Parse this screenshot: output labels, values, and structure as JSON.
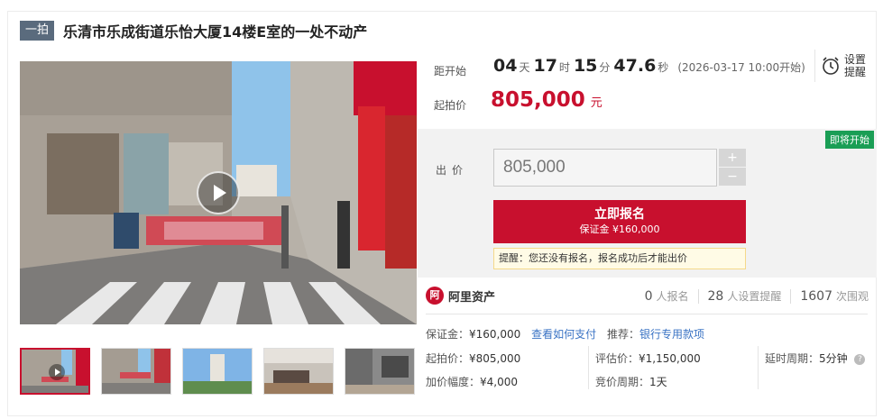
{
  "header": {
    "tag": "一拍",
    "title": "乐清市乐成街道乐怡大厦14楼E室的一处不动产"
  },
  "countdown": {
    "label": "距开始",
    "days": "04",
    "days_unit": "天",
    "hours": "17",
    "hours_unit": "时",
    "minutes": "15",
    "minutes_unit": "分",
    "seconds": "47.6",
    "seconds_unit": "秒",
    "start_time": "(2026-03-17 10:00开始)"
  },
  "remind": {
    "label": "设置提醒"
  },
  "start_price": {
    "label": "起拍价",
    "value": "805,000",
    "unit": "元"
  },
  "bid": {
    "status_badge": "即将开始",
    "label": "出价",
    "input_value": "805,000",
    "plus": "+",
    "minus": "−",
    "signup_label": "立即报名",
    "deposit_label": "保证金 ¥160,000",
    "hint": "提醒：您还没有报名，报名成功后才能出价"
  },
  "platform": {
    "logo": "阿",
    "name": "阿里资产"
  },
  "stats": {
    "signups": "0",
    "signups_label": "人报名",
    "reminders": "28",
    "reminders_label": "人设置提醒",
    "views": "1607",
    "views_label": "次围观"
  },
  "info": {
    "deposit_label": "保证金：",
    "deposit_value": "¥160,000",
    "payment_link": "查看如何支付",
    "recommend_label": "推荐：",
    "recommend_link": "银行专用款项",
    "start_price_label": "起拍价：",
    "start_price_value": "¥805,000",
    "appraisal_label": "评估价：",
    "appraisal_value": "¥1,150,000",
    "delay_label": "延时周期：",
    "delay_value": "5分钟",
    "increment_label": "加价幅度：",
    "increment_value": "¥4,000",
    "cycle_label": "竞价周期：",
    "cycle_value": "1天"
  },
  "colors": {
    "accent": "#c8102e",
    "tag": "#5a6b7d",
    "badge": "#1a9e55",
    "link": "#3a73c4"
  }
}
